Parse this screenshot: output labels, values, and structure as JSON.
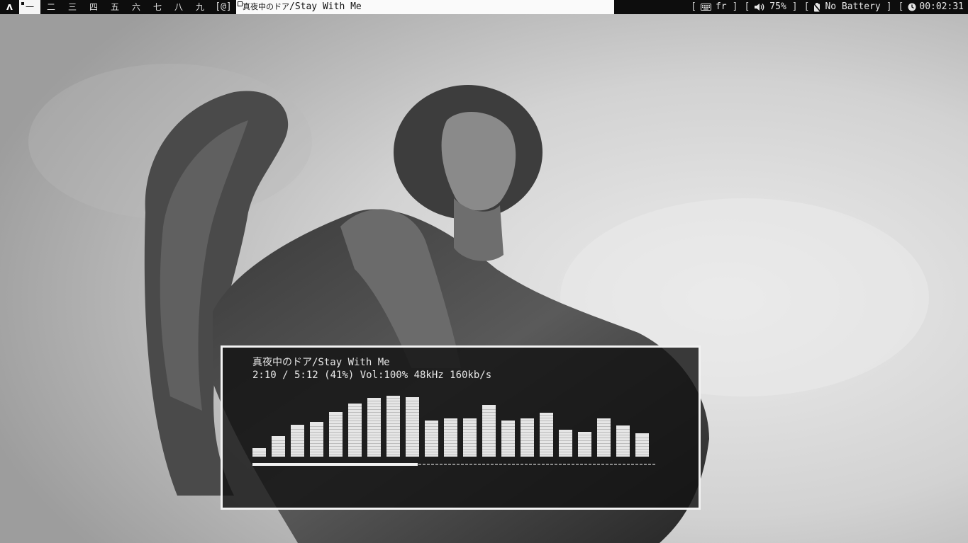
{
  "topbar": {
    "launcher_glyph": "ʌ",
    "workspaces": [
      "一",
      "二",
      "三",
      "四",
      "五",
      "六",
      "七",
      "八",
      "九"
    ],
    "active_workspace": 0,
    "layout_symbol": "[@]",
    "window_title_jp": "真夜中のドア",
    "window_title_rest": "/Stay With Me",
    "keyboard": {
      "icon": "keyboard-icon",
      "value": "fr"
    },
    "volume": {
      "icon": "speaker-icon",
      "value": "75%"
    },
    "battery": {
      "icon": "no-battery-icon",
      "value": "No Battery"
    },
    "clock": {
      "icon": "clock-icon",
      "value": "00:02:31"
    }
  },
  "player": {
    "song_jp": "真夜中のドア",
    "song_rest": "/Stay With Me",
    "stats": "2:10 / 5:12 (41%) Vol:100% 48kHz 160kb/s",
    "progress": 0.41,
    "visualizer_levels": [
      0.13,
      0.31,
      0.49,
      0.53,
      0.68,
      0.81,
      0.9,
      0.94,
      0.91,
      0.55,
      0.59,
      0.59,
      0.79,
      0.55,
      0.59,
      0.67,
      0.41,
      0.38,
      0.59,
      0.48,
      0.36
    ]
  },
  "colors": {
    "bar_bg": "#0d0d0d",
    "accent": "#f2f2f2"
  }
}
